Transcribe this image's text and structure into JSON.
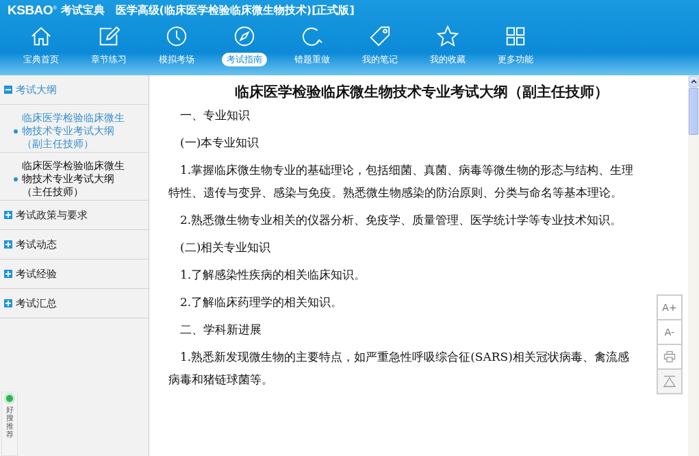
{
  "header": {
    "logo": "KSBAO",
    "logo_mark": "®",
    "logo_cn": "考试宝典",
    "title": "医学高级(临床医学检验临床微生物技术)[正式版]"
  },
  "nav": [
    {
      "label": "宝典首页",
      "kind": "home",
      "selected": false
    },
    {
      "label": "章节练习",
      "kind": "edit",
      "selected": false
    },
    {
      "label": "模拟考场",
      "kind": "clock",
      "selected": false
    },
    {
      "label": "考试指南",
      "kind": "compass",
      "selected": true
    },
    {
      "label": "错题重做",
      "kind": "redo",
      "selected": false
    },
    {
      "label": "我的笔记",
      "kind": "tag",
      "selected": false
    },
    {
      "label": "我的收藏",
      "kind": "star",
      "selected": false
    },
    {
      "label": "更多功能",
      "kind": "grid",
      "selected": false
    }
  ],
  "sidebar": {
    "groups": [
      {
        "label": "考试大纲",
        "expanded": true,
        "children": [
          {
            "label": "临床医学检验临床微生物技术专业考试大纲（副主任技师）",
            "selected": true
          },
          {
            "label": "临床医学检验临床微生物技术专业考试大纲（主任技师）",
            "selected": false
          }
        ]
      },
      {
        "label": "考试政策与要求",
        "expanded": false
      },
      {
        "label": "考试动态",
        "expanded": false
      },
      {
        "label": "考试经验",
        "expanded": false
      },
      {
        "label": "考试汇总",
        "expanded": false
      }
    ]
  },
  "recommend": {
    "label": "好搜推荐"
  },
  "article": {
    "title": "临床医学检验临床微生物技术专业考试大纲（副主任技师）",
    "paragraphs": [
      "一、专业知识",
      "(一)本专业知识",
      "1.掌握临床微生物专业的基础理论，包括细菌、真菌、病毒等微生物的形态与结构、生理特性、遗传与变异、感染与免疫。熟悉微生物感染的防治原则、分类与命名等基本理论。",
      "2.熟悉微生物专业相关的仪器分析、免疫学、质量管理、医学统计学等专业技术知识。",
      "(二)相关专业知识",
      "1.了解感染性疾病的相关临床知识。",
      "2.了解临床药理学的相关知识。",
      "二、学科新进展",
      "1.熟悉新发现微生物的主要特点，如严重急性呼吸综合征(SARS)相关冠状病毒、禽流感病毒和猪链球菌等。"
    ]
  },
  "tools": [
    {
      "kind": "text",
      "label": "A+"
    },
    {
      "kind": "text",
      "label": "A-"
    },
    {
      "kind": "print"
    },
    {
      "kind": "top"
    }
  ]
}
